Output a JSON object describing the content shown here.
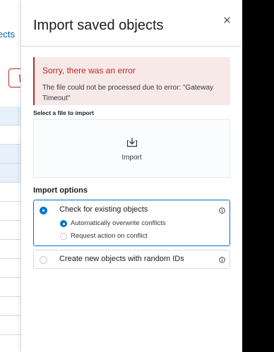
{
  "background": {
    "link_text": "ects"
  },
  "flyout": {
    "title": "Import saved objects",
    "error_callout": {
      "title": "Sorry, there was an error",
      "message": "The file could not be processed due to error: \"Gateway Timeout\""
    },
    "file_picker": {
      "label": "Select a file to import",
      "button_text": "Import",
      "icon": "import-icon"
    },
    "import_options": {
      "heading": "Import options",
      "check_existing": {
        "label": "Check for existing objects",
        "selected": true,
        "sub_options": [
          {
            "label": "Automatically overwrite conflicts",
            "selected": true
          },
          {
            "label": "Request action on conflict",
            "selected": false
          }
        ]
      },
      "create_new": {
        "label": "Create new objects with random IDs",
        "selected": false
      }
    }
  },
  "colors": {
    "accent": "#0077cc",
    "danger": "#bd271e",
    "danger_bg": "#f8e9e9"
  }
}
